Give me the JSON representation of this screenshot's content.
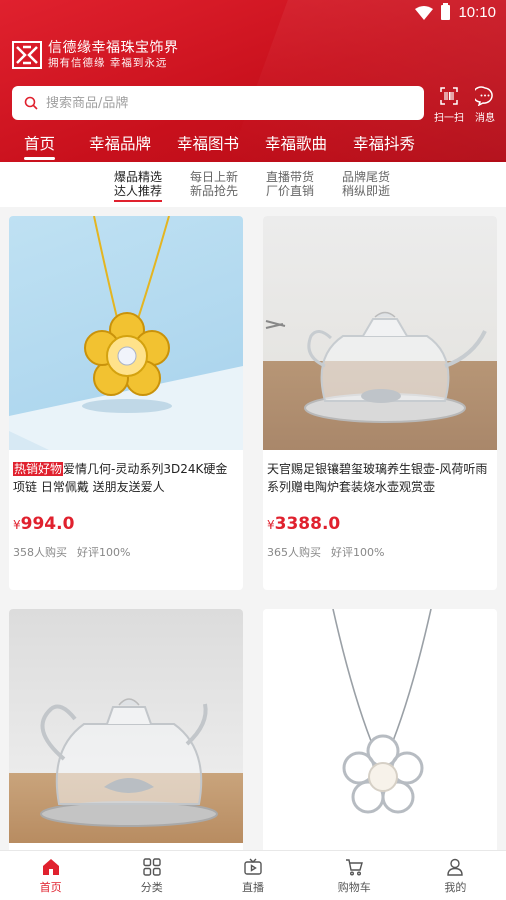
{
  "status": {
    "time": "10:10"
  },
  "brand": {
    "title": "信德缘幸福珠宝饰界",
    "subtitle": "拥有信德缘 幸福到永远"
  },
  "search": {
    "placeholder": "搜索商品/品牌"
  },
  "actions": {
    "scan_label": "扫一扫",
    "message_label": "消息"
  },
  "top_nav": [
    {
      "label": "首页",
      "active": true
    },
    {
      "label": "幸福品牌"
    },
    {
      "label": "幸福图书"
    },
    {
      "label": "幸福歌曲"
    },
    {
      "label": "幸福抖秀"
    }
  ],
  "sub_tabs": [
    {
      "line1": "爆品精选",
      "line2": "达人推荐",
      "active": true
    },
    {
      "line1": "每日上新",
      "line2": "新品抢先"
    },
    {
      "line1": "直播带货",
      "line2": "厂价直销"
    },
    {
      "line1": "品牌尾货",
      "line2": "稍纵即逝"
    }
  ],
  "products": [
    {
      "tag": "热销好物",
      "title": "爱情几何-灵动系列3D24K硬金项链 日常佩戴 送朋友送爱人",
      "currency": "¥",
      "price": "994.0",
      "sold": "358人购买",
      "rating": "好评100%"
    },
    {
      "tag": "",
      "title": "天官赐足银镶碧玺玻璃养生银壶-风荷听雨系列赠电陶炉套装烧水壶观赏壶",
      "currency": "¥",
      "price": "3388.0",
      "sold": "365人购买",
      "rating": "好评100%"
    },
    {
      "tag": "",
      "title": "",
      "currency": "",
      "price": "",
      "sold": "",
      "rating": ""
    },
    {
      "tag": "",
      "title": "",
      "currency": "",
      "price": "",
      "sold": "",
      "rating": ""
    }
  ],
  "bottom_nav": [
    {
      "label": "首页",
      "icon": "home-icon",
      "active": true
    },
    {
      "label": "分类",
      "icon": "category-icon"
    },
    {
      "label": "直播",
      "icon": "live-icon"
    },
    {
      "label": "购物车",
      "icon": "cart-icon"
    },
    {
      "label": "我的",
      "icon": "profile-icon"
    }
  ],
  "colors": {
    "brand_red": "#e0212e",
    "price_red": "#e0212e"
  }
}
